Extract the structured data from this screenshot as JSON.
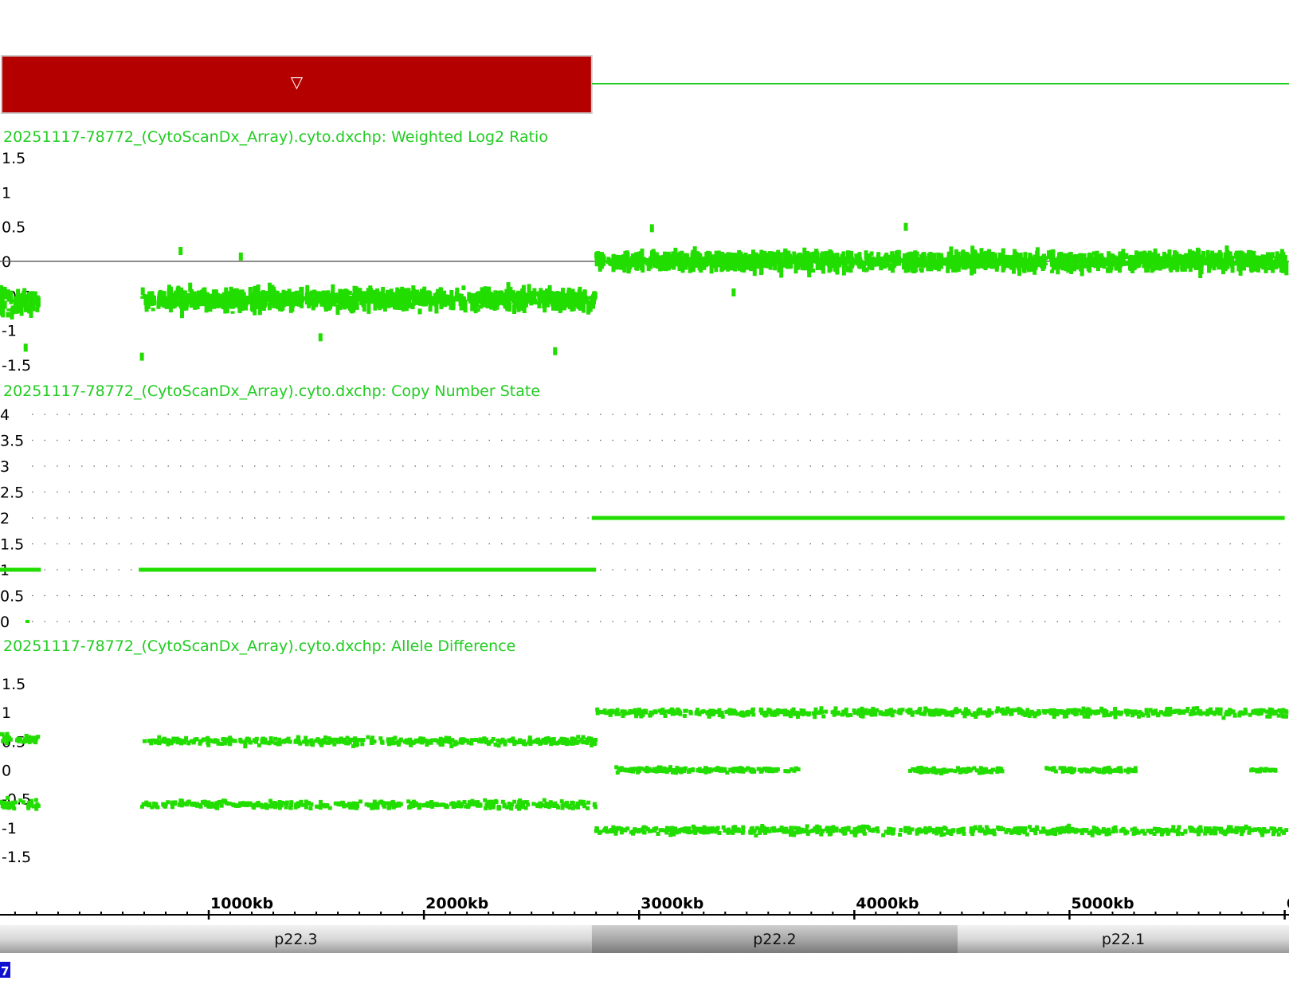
{
  "segment_bar": {
    "color": "#b50000",
    "marker_icon": "down-triangle-icon",
    "marker_glyph": "▽",
    "start_kb": 0,
    "end_kb": 2780
  },
  "colors": {
    "data": "#22dd00",
    "title": "#22cc22",
    "segment": "#b50000",
    "baseline": "#666666"
  },
  "chart_data": [
    {
      "type": "scatter",
      "title": "20251117-78772_(CytoScanDx_Array).cyto.dxchp: Weighted Log2 Ratio",
      "yticks": [
        "1.5",
        "1",
        "0.5",
        "0",
        "-0.5",
        "-1",
        "-1.5"
      ],
      "ylim": [
        -1.5,
        1.5
      ],
      "baseline_y": 0,
      "x_unit": "kb",
      "segments": [
        {
          "x_start": 0,
          "x_end": 200,
          "mean": -0.6,
          "spread": 0.15
        },
        {
          "x_start": 680,
          "x_end": 2790,
          "mean": -0.55,
          "spread": 0.12
        },
        {
          "x_start": 2790,
          "x_end": 6000,
          "mean": 0.0,
          "spread": 0.1
        }
      ],
      "outliers": [
        {
          "x": 860,
          "y": 0.15
        },
        {
          "x": 1140,
          "y": 0.07
        },
        {
          "x": 3050,
          "y": 0.48
        },
        {
          "x": 4230,
          "y": 0.5
        },
        {
          "x": 140,
          "y": -1.25
        },
        {
          "x": 2600,
          "y": -1.3
        },
        {
          "x": 680,
          "y": -1.38
        },
        {
          "x": 3430,
          "y": -0.45
        },
        {
          "x": 1510,
          "y": -1.1
        }
      ]
    },
    {
      "type": "line",
      "title": "20251117-78772_(CytoScanDx_Array).cyto.dxchp: Copy Number State",
      "yticks": [
        "4",
        "3.5",
        "3",
        "2.5",
        "2",
        "1.5",
        "1",
        "0.5",
        "0"
      ],
      "ylim": [
        0,
        4
      ],
      "grid": "dotted",
      "x_unit": "kb",
      "series": [
        {
          "x_start": 0,
          "x_end": 220,
          "value": 1
        },
        {
          "x_start": 675,
          "x_end": 2800,
          "value": 1
        },
        {
          "x_start": 2780,
          "x_end": 6000,
          "value": 2
        }
      ]
    },
    {
      "type": "scatter",
      "title": "20251117-78772_(CytoScanDx_Array).cyto.dxchp: Allele Difference",
      "yticks": [
        "1.5",
        "1",
        "0.5",
        "0",
        "-0.5",
        "-1",
        "-1.5"
      ],
      "ylim": [
        -1.5,
        1.5
      ],
      "x_unit": "kb",
      "bands": [
        {
          "x_start": 0,
          "x_end": 200,
          "y": 0.55,
          "spread": 0.08
        },
        {
          "x_start": 0,
          "x_end": 200,
          "y": -0.6,
          "spread": 0.08
        },
        {
          "x_start": 680,
          "x_end": 2790,
          "y": 0.5,
          "spread": 0.06
        },
        {
          "x_start": 680,
          "x_end": 2790,
          "y": -0.6,
          "spread": 0.06
        },
        {
          "x_start": 2790,
          "x_end": 6000,
          "y": 1.0,
          "spread": 0.06
        },
        {
          "x_start": 2880,
          "x_end": 3740,
          "y": 0.0,
          "spread": 0.04
        },
        {
          "x_start": 4250,
          "x_end": 4680,
          "y": 0.0,
          "spread": 0.04
        },
        {
          "x_start": 4880,
          "x_end": 5300,
          "y": 0.0,
          "spread": 0.04
        },
        {
          "x_start": 5830,
          "x_end": 5950,
          "y": 0.0,
          "spread": 0.02
        },
        {
          "x_start": 2790,
          "x_end": 6000,
          "y": -1.05,
          "spread": 0.06
        }
      ]
    }
  ],
  "x_axis": {
    "tick_labels": [
      "1000kb",
      "2000kb",
      "3000kb",
      "4000kb",
      "5000kb",
      "6"
    ],
    "tick_values_kb": [
      1000,
      2000,
      3000,
      4000,
      5000,
      6000
    ],
    "visible_range_kb": [
      30,
      6020
    ]
  },
  "cytobands": [
    {
      "label": "p22.3",
      "start_kb": 0,
      "end_kb": 2780,
      "shade": "light"
    },
    {
      "label": "p22.2",
      "start_kb": 2780,
      "end_kb": 4480,
      "shade": "dark"
    },
    {
      "label": "p22.1",
      "start_kb": 4480,
      "end_kb": 6020,
      "shade": "light"
    }
  ],
  "corner_badge": {
    "label": "7",
    "color": "#1010d0"
  }
}
